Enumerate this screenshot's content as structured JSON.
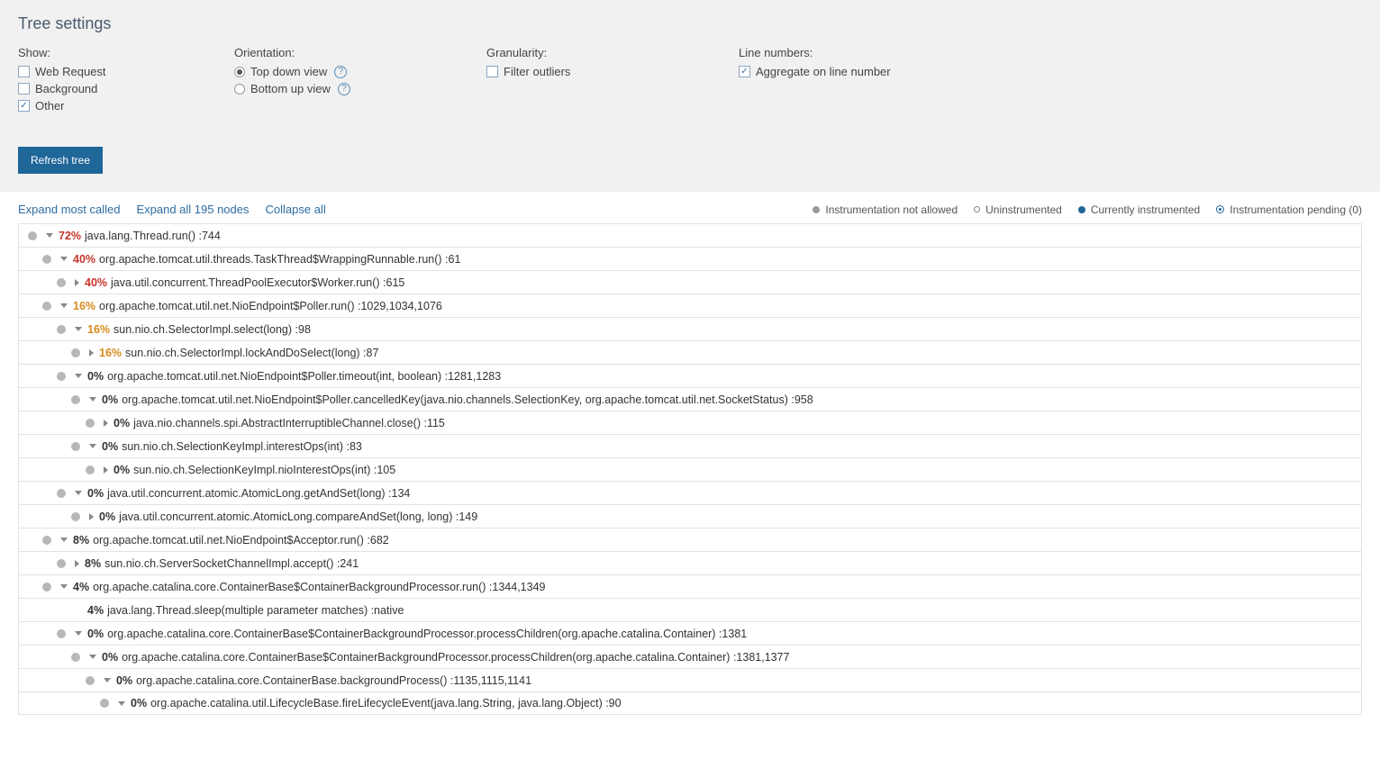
{
  "settings": {
    "title": "Tree settings",
    "show": {
      "label": "Show:",
      "web_request": "Web Request",
      "background": "Background",
      "other": "Other"
    },
    "orientation": {
      "label": "Orientation:",
      "top_down": "Top down view",
      "bottom_up": "Bottom up view"
    },
    "granularity": {
      "label": "Granularity:",
      "filter_outliers": "Filter outliers"
    },
    "line_numbers": {
      "label": "Line numbers:",
      "aggregate": "Aggregate on line number"
    },
    "refresh": "Refresh tree"
  },
  "toolbar": {
    "expand_most": "Expand most called",
    "expand_all": "Expand all 195 nodes",
    "collapse_all": "Collapse all",
    "legend": {
      "not_allowed": "Instrumentation not allowed",
      "uninstrumented": "Uninstrumented",
      "currently": "Currently instrumented",
      "pending": "Instrumentation pending (0)"
    }
  },
  "tree": [
    {
      "depth": 0,
      "status": "grey",
      "caret": "down",
      "pct": "72%",
      "pctClass": "red",
      "method": "java.lang.Thread.run() :744"
    },
    {
      "depth": 1,
      "status": "grey",
      "caret": "down",
      "pct": "40%",
      "pctClass": "red",
      "method": "org.apache.tomcat.util.threads.TaskThread$WrappingRunnable.run() :61"
    },
    {
      "depth": 2,
      "status": "grey",
      "caret": "right",
      "pct": "40%",
      "pctClass": "red",
      "method": "java.util.concurrent.ThreadPoolExecutor$Worker.run() :615"
    },
    {
      "depth": 1,
      "status": "grey",
      "caret": "down",
      "pct": "16%",
      "pctClass": "orange",
      "method": "org.apache.tomcat.util.net.NioEndpoint$Poller.run() :1029,1034,1076"
    },
    {
      "depth": 2,
      "status": "grey",
      "caret": "down",
      "pct": "16%",
      "pctClass": "orange",
      "method": "sun.nio.ch.SelectorImpl.select(long) :98"
    },
    {
      "depth": 3,
      "status": "grey",
      "caret": "right",
      "pct": "16%",
      "pctClass": "orange",
      "method": "sun.nio.ch.SelectorImpl.lockAndDoSelect(long) :87"
    },
    {
      "depth": 2,
      "status": "grey",
      "caret": "down",
      "pct": "0%",
      "pctClass": "black",
      "method": "org.apache.tomcat.util.net.NioEndpoint$Poller.timeout(int, boolean) :1281,1283"
    },
    {
      "depth": 3,
      "status": "grey",
      "caret": "down",
      "pct": "0%",
      "pctClass": "black",
      "method": "org.apache.tomcat.util.net.NioEndpoint$Poller.cancelledKey(java.nio.channels.SelectionKey, org.apache.tomcat.util.net.SocketStatus) :958"
    },
    {
      "depth": 4,
      "status": "grey",
      "caret": "right",
      "pct": "0%",
      "pctClass": "black",
      "method": "java.nio.channels.spi.AbstractInterruptibleChannel.close() :115"
    },
    {
      "depth": 3,
      "status": "grey",
      "caret": "down",
      "pct": "0%",
      "pctClass": "black",
      "method": "sun.nio.ch.SelectionKeyImpl.interestOps(int) :83"
    },
    {
      "depth": 4,
      "status": "grey",
      "caret": "right",
      "pct": "0%",
      "pctClass": "black",
      "method": "sun.nio.ch.SelectionKeyImpl.nioInterestOps(int) :105"
    },
    {
      "depth": 2,
      "status": "grey",
      "caret": "down",
      "pct": "0%",
      "pctClass": "black",
      "method": "java.util.concurrent.atomic.AtomicLong.getAndSet(long) :134"
    },
    {
      "depth": 3,
      "status": "grey",
      "caret": "right",
      "pct": "0%",
      "pctClass": "black",
      "method": "java.util.concurrent.atomic.AtomicLong.compareAndSet(long, long) :149"
    },
    {
      "depth": 1,
      "status": "grey",
      "caret": "down",
      "pct": "8%",
      "pctClass": "black",
      "method": "org.apache.tomcat.util.net.NioEndpoint$Acceptor.run() :682"
    },
    {
      "depth": 2,
      "status": "grey",
      "caret": "right",
      "pct": "8%",
      "pctClass": "black",
      "method": "sun.nio.ch.ServerSocketChannelImpl.accept() :241"
    },
    {
      "depth": 1,
      "status": "grey",
      "caret": "down",
      "pct": "4%",
      "pctClass": "black",
      "method": "org.apache.catalina.core.ContainerBase$ContainerBackgroundProcessor.run() :1344,1349"
    },
    {
      "depth": 2,
      "status": "none",
      "caret": "none",
      "pct": "4%",
      "pctClass": "black",
      "method": "java.lang.Thread.sleep(multiple parameter matches) :native"
    },
    {
      "depth": 2,
      "status": "grey",
      "caret": "down",
      "pct": "0%",
      "pctClass": "black",
      "method": "org.apache.catalina.core.ContainerBase$ContainerBackgroundProcessor.processChildren(org.apache.catalina.Container) :1381"
    },
    {
      "depth": 3,
      "status": "grey",
      "caret": "down",
      "pct": "0%",
      "pctClass": "black",
      "method": "org.apache.catalina.core.ContainerBase$ContainerBackgroundProcessor.processChildren(org.apache.catalina.Container) :1381,1377"
    },
    {
      "depth": 4,
      "status": "grey",
      "caret": "down",
      "pct": "0%",
      "pctClass": "black",
      "method": "org.apache.catalina.core.ContainerBase.backgroundProcess() :1135,1115,1141"
    },
    {
      "depth": 5,
      "status": "grey",
      "caret": "down",
      "pct": "0%",
      "pctClass": "black",
      "method": "org.apache.catalina.util.LifecycleBase.fireLifecycleEvent(java.lang.String, java.lang.Object) :90"
    }
  ]
}
